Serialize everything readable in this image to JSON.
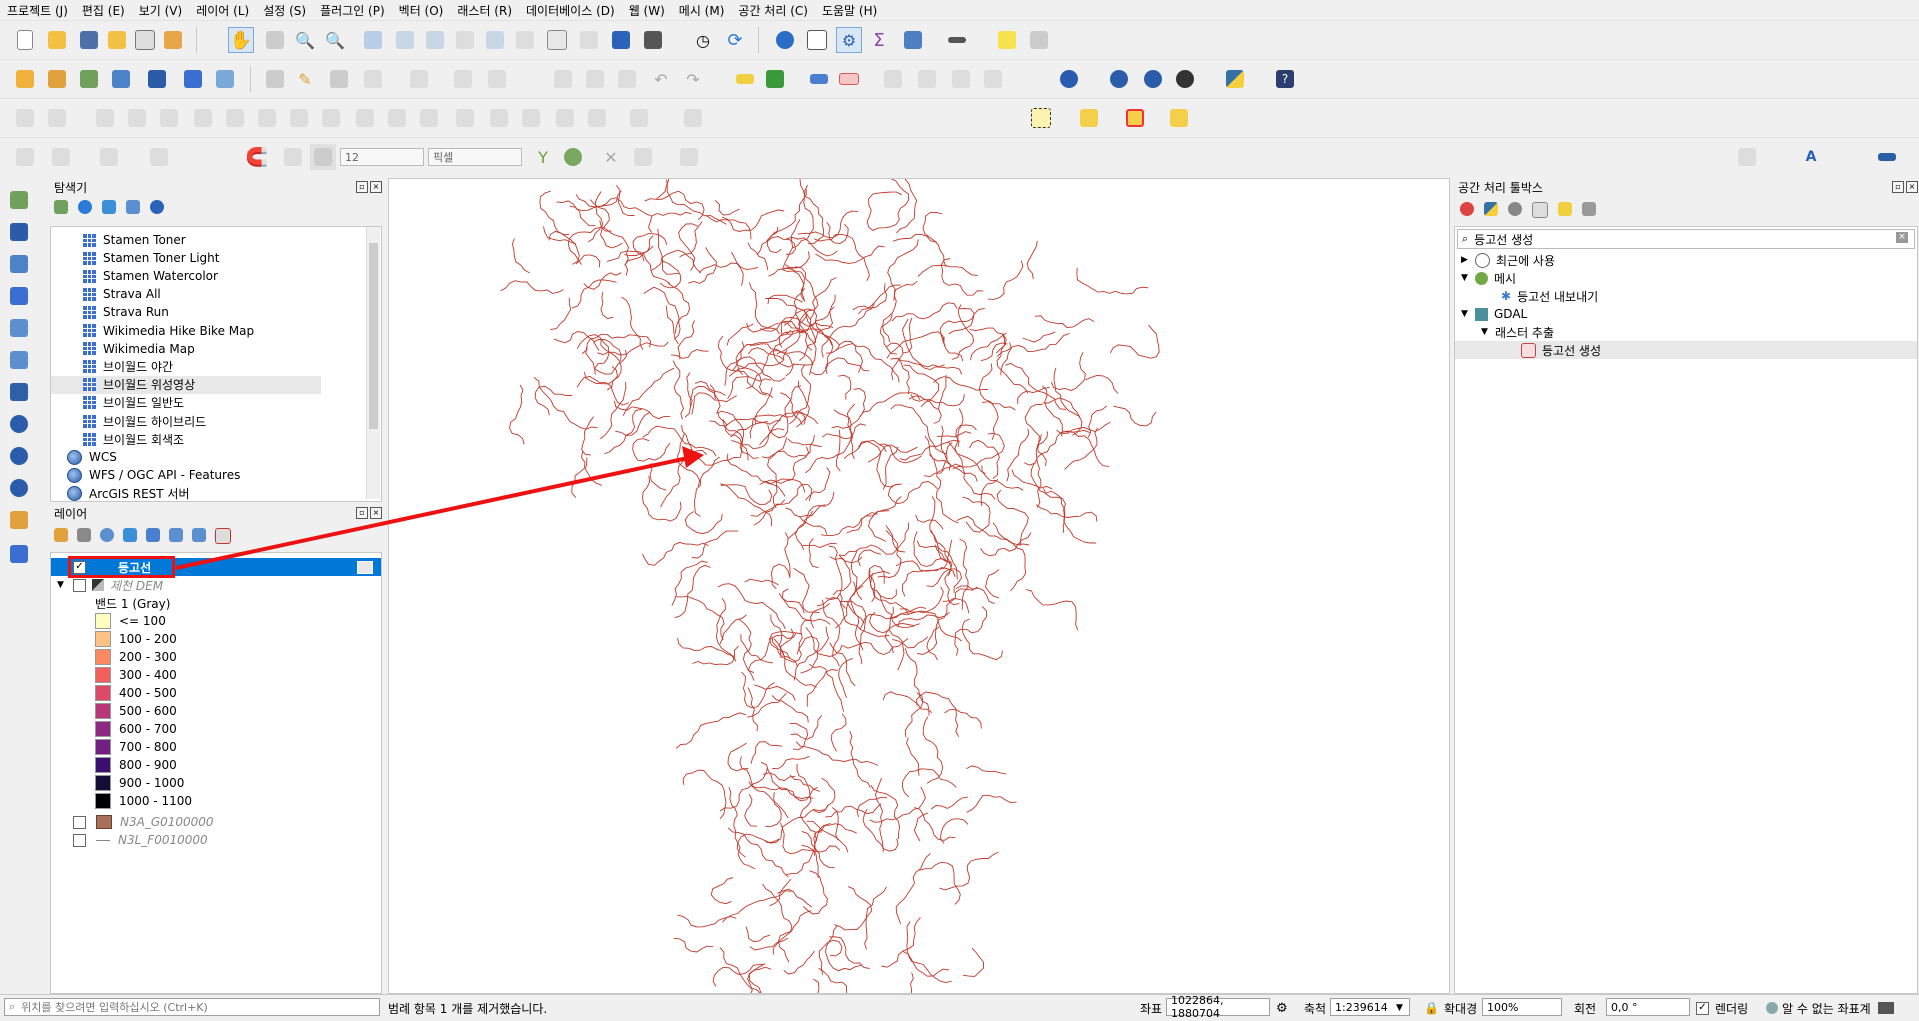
{
  "menu": [
    "프로젝트 (J)",
    "편집 (E)",
    "보기 (V)",
    "레이어 (L)",
    "설정 (S)",
    "플러그인 (P)",
    "벡터 (O)",
    "래스터 (R)",
    "데이터베이스 (D)",
    "웹 (W)",
    "메시 (M)",
    "공간 처리 (C)",
    "도움말 (H)"
  ],
  "toolbar": {
    "snap_size": "12",
    "snap_unit": "픽셀"
  },
  "browser": {
    "title": "탐색기",
    "items": [
      {
        "label": "Stamen Toner",
        "icon": "xyz-tile-icon"
      },
      {
        "label": "Stamen Toner Light",
        "icon": "xyz-tile-icon"
      },
      {
        "label": "Stamen Watercolor",
        "icon": "xyz-tile-icon"
      },
      {
        "label": "Strava All",
        "icon": "xyz-tile-icon"
      },
      {
        "label": "Strava Run",
        "icon": "xyz-tile-icon"
      },
      {
        "label": "Wikimedia Hike Bike Map",
        "icon": "xyz-tile-icon"
      },
      {
        "label": "Wikimedia Map",
        "icon": "xyz-tile-icon"
      },
      {
        "label": "브이월드 야간",
        "icon": "xyz-tile-icon"
      },
      {
        "label": "브이월드 위성영상",
        "icon": "xyz-tile-icon"
      },
      {
        "label": "브이월드 일반도",
        "icon": "xyz-tile-icon"
      },
      {
        "label": "브이월드 하이브리드",
        "icon": "xyz-tile-icon"
      },
      {
        "label": "브이월드 회색조",
        "icon": "xyz-tile-icon"
      },
      {
        "label": "WCS",
        "icon": "globe-icon"
      },
      {
        "label": "WFS / OGC API - Features",
        "icon": "globe-icon"
      },
      {
        "label": "ArcGIS REST 서버",
        "icon": "globe-icon"
      }
    ]
  },
  "layers": {
    "title": "레이어",
    "contour_layer": "등고선",
    "dem_layer": "제천 DEM",
    "band": "밴드 1 (Gray)",
    "legend": [
      {
        "label": "<= 100",
        "color": "#fcfdbf"
      },
      {
        "label": "100 - 200",
        "color": "#fec287"
      },
      {
        "label": "200 - 300",
        "color": "#fc8961"
      },
      {
        "label": "300 - 400",
        "color": "#f1605d"
      },
      {
        "label": "400 - 500",
        "color": "#de4968"
      },
      {
        "label": "500 - 600",
        "color": "#b73779"
      },
      {
        "label": "600 - 700",
        "color": "#8c2981"
      },
      {
        "label": "700 - 800",
        "color": "#721f81"
      },
      {
        "label": "800 - 900",
        "color": "#3b0f70"
      },
      {
        "label": "900 - 1000",
        "color": "#140e36"
      },
      {
        "label": "1000 - 1100",
        "color": "#000004"
      }
    ],
    "layer_a": "N3A_G0100000",
    "layer_b": "N3L_F0010000"
  },
  "toolbox": {
    "title": "공간 처리 툴박스",
    "search": "등고선 생성",
    "recent": "최근에 사용",
    "mesh": "메시",
    "mesh_export": "등고선 내보내기",
    "gdal": "GDAL",
    "raster_extract": "래스터 추출",
    "contour_tool": "등고선 생성"
  },
  "status": {
    "locator_placeholder": "위치를 찾으려면 입력하십시오 (Ctrl+K)",
    "message": "범례 항목 1 개를 제거했습니다.",
    "coord_label": "좌표",
    "coord_value": "1022864, 1880704",
    "scale_label": "축척",
    "scale_value": "1:239614",
    "magnifier_label": "확대경",
    "magnifier_value": "100%",
    "rotation_label": "회전",
    "rotation_value": "0,0 °",
    "render_label": "렌더링",
    "crs_label": "알 수 없는 좌표계"
  },
  "colors": {
    "contour": "#c0392b",
    "annotation_arrow": "#ee1111",
    "selection": "#0078d7"
  }
}
